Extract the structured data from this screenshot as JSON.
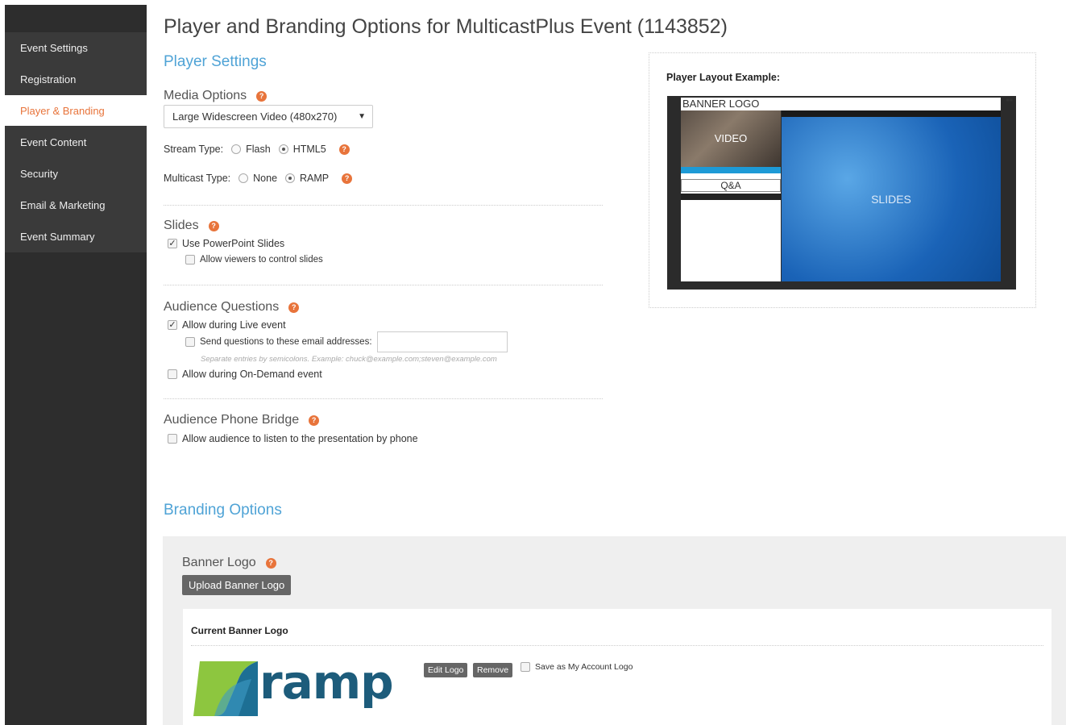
{
  "sidebar": {
    "items": [
      {
        "label": "Event Settings"
      },
      {
        "label": "Registration"
      },
      {
        "label": "Player & Branding"
      },
      {
        "label": "Event Content"
      },
      {
        "label": "Security"
      },
      {
        "label": "Email & Marketing"
      },
      {
        "label": "Event Summary"
      }
    ],
    "active_index": 2
  },
  "page_title": "Player and Branding Options for MulticastPlus Event (1143852)",
  "player_settings": {
    "heading": "Player Settings",
    "media_options": {
      "title": "Media Options",
      "selected": "Large Widescreen Video (480x270)"
    },
    "stream_type": {
      "label": "Stream Type:",
      "options": [
        "Flash",
        "HTML5"
      ],
      "selected": "HTML5"
    },
    "multicast_type": {
      "label": "Multicast Type:",
      "options": [
        "None",
        "RAMP"
      ],
      "selected": "RAMP"
    },
    "slides": {
      "title": "Slides",
      "use_ppt": {
        "label": "Use PowerPoint Slides",
        "checked": true
      },
      "allow_control": {
        "label": "Allow viewers to control slides",
        "checked": false
      }
    },
    "audience_questions": {
      "title": "Audience Questions",
      "live": {
        "label": "Allow during Live event",
        "checked": true
      },
      "send_email": {
        "label": "Send questions to these email addresses:",
        "checked": false,
        "value": ""
      },
      "hint": "Separate entries by semicolons. Example: chuck@example.com;steven@example.com",
      "on_demand": {
        "label": "Allow during On-Demand event",
        "checked": false
      }
    },
    "phone_bridge": {
      "title": "Audience Phone Bridge",
      "allow": {
        "label": "Allow audience to listen to the presentation by phone",
        "checked": false
      }
    }
  },
  "layout_example": {
    "title": "Player Layout Example:",
    "banner": "BANNER LOGO",
    "video": "VIDEO",
    "qa": "Q&A",
    "slides": "SLIDES"
  },
  "branding": {
    "heading": "Branding Options",
    "banner_logo_title": "Banner Logo",
    "upload_label": "Upload Banner Logo",
    "current_title": "Current Banner Logo",
    "logo_text": "ramp",
    "edit_label": "Edit Logo",
    "remove_label": "Remove",
    "save_account": {
      "label": "Save as My Account Logo",
      "checked": false
    }
  },
  "help_glyph": "?",
  "colors": {
    "accent": "#4fa3d6",
    "active_nav": "#e8743b",
    "sidebar": "#2d2d2d",
    "logo_green": "#8dc63f",
    "logo_blue": "#1d5c7b"
  }
}
